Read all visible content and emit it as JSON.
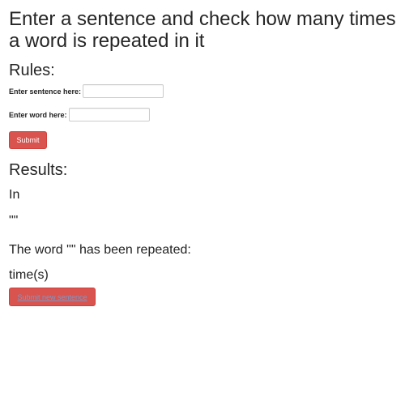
{
  "page": {
    "title": "Enter a sentence and check how many times a word is repeated in it"
  },
  "rules": {
    "heading": "Rules:",
    "sentence_label": "Enter sentence here:",
    "sentence_value": "",
    "word_label": "Enter word here:",
    "word_value": "",
    "submit_label": "Submit"
  },
  "results": {
    "heading": "Results:",
    "in_label": "In",
    "sentence_quoted": "\"\"",
    "word_repeated_text": "The word \"\" has been repeated:",
    "times_text": "time(s)",
    "new_button_label": "Submit new sentence"
  },
  "colors": {
    "button_bg": "#d9534f",
    "button_link_text": "#7a9ac9"
  }
}
